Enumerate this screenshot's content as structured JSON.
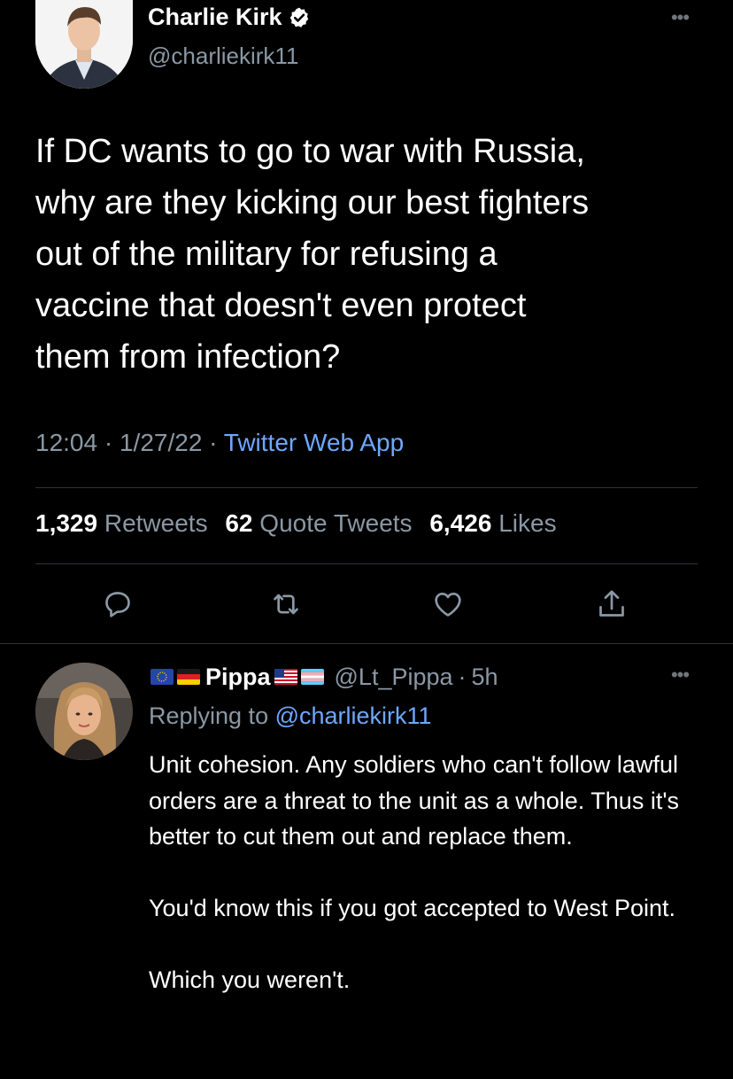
{
  "main_tweet": {
    "author": {
      "name": "Charlie Kirk",
      "handle": "@charliekirk11"
    },
    "text": "If DC wants to go to war with Russia,\nwhy are they kicking our best fighters\nout of the military for refusing a\nvaccine that doesn't even protect\nthem from infection?",
    "time": "12:04",
    "date": "1/27/22",
    "separator": "·",
    "source": "Twitter Web App",
    "stats": {
      "retweets_count": "1,329",
      "retweets_label": "Retweets",
      "quotes_count": "62",
      "quotes_label": "Quote Tweets",
      "likes_count": "6,426",
      "likes_label": "Likes"
    }
  },
  "icons": {
    "verified": "verified-badge-icon",
    "more": "more-horizontal-icon",
    "reply": "reply-icon",
    "retweet": "retweet-icon",
    "like": "heart-icon",
    "share": "share-icon",
    "flags": [
      "eu-flag",
      "germany-flag",
      "usa-flag",
      "trans-flag"
    ]
  },
  "reply": {
    "name": "Pippa",
    "handle": "@Lt_Pippa",
    "separator": "·",
    "time": "5h",
    "replying_label": "Replying to",
    "replying_to": "@charliekirk11",
    "paragraphs": [
      "Unit cohesion. Any soldiers who can't follow lawful orders are a threat to the unit as a whole. Thus it's better to cut them out and replace them.",
      "You'd know this if you got accepted to West Point.",
      "Which you weren't."
    ]
  },
  "colors": {
    "background": "#000000",
    "primary_text": "#ffffff",
    "secondary_text": "#8b98a5",
    "link": "#6ea8fe",
    "divider": "#2f3336",
    "verified": "#ffffff"
  }
}
